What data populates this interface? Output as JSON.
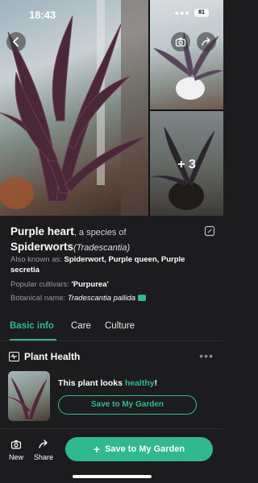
{
  "status_bar": {
    "time": "18:43",
    "battery": "81"
  },
  "gallery": {
    "more_photos": "+ 3"
  },
  "plant": {
    "common_name": "Purple heart",
    "species_connector": ", a species of",
    "genus": "Spiderworts",
    "genus_latin": "(Tradescantia)",
    "aka_label": "Also known as: ",
    "aka_value": "Spiderwort, Purple queen, Purple secretia",
    "cultivars_label": "Popular cultivars: ",
    "cultivars_value": "'Purpurea'",
    "botanical_label": "Botanical name: ",
    "botanical_value": "Tradescantia pallida"
  },
  "tabs": [
    {
      "label": "Basic info",
      "active": true
    },
    {
      "label": "Care",
      "active": false
    },
    {
      "label": "Culture",
      "active": false
    }
  ],
  "health": {
    "title": "Plant Health",
    "status_prefix": "This plant looks ",
    "status_value": "healthy",
    "status_suffix": "!",
    "save_button": "Save to My Garden"
  },
  "bottom_bar": {
    "new_label": "New",
    "share_label": "Share",
    "save_label": "Save to My Garden"
  },
  "colors": {
    "accent": "#2fb98d",
    "background": "#1c1c1e"
  },
  "icons": [
    "back-arrow-icon",
    "camera-icon",
    "share-icon",
    "edit-icon",
    "speaker-icon",
    "pulse-icon",
    "more-icon",
    "plus-icon"
  ]
}
